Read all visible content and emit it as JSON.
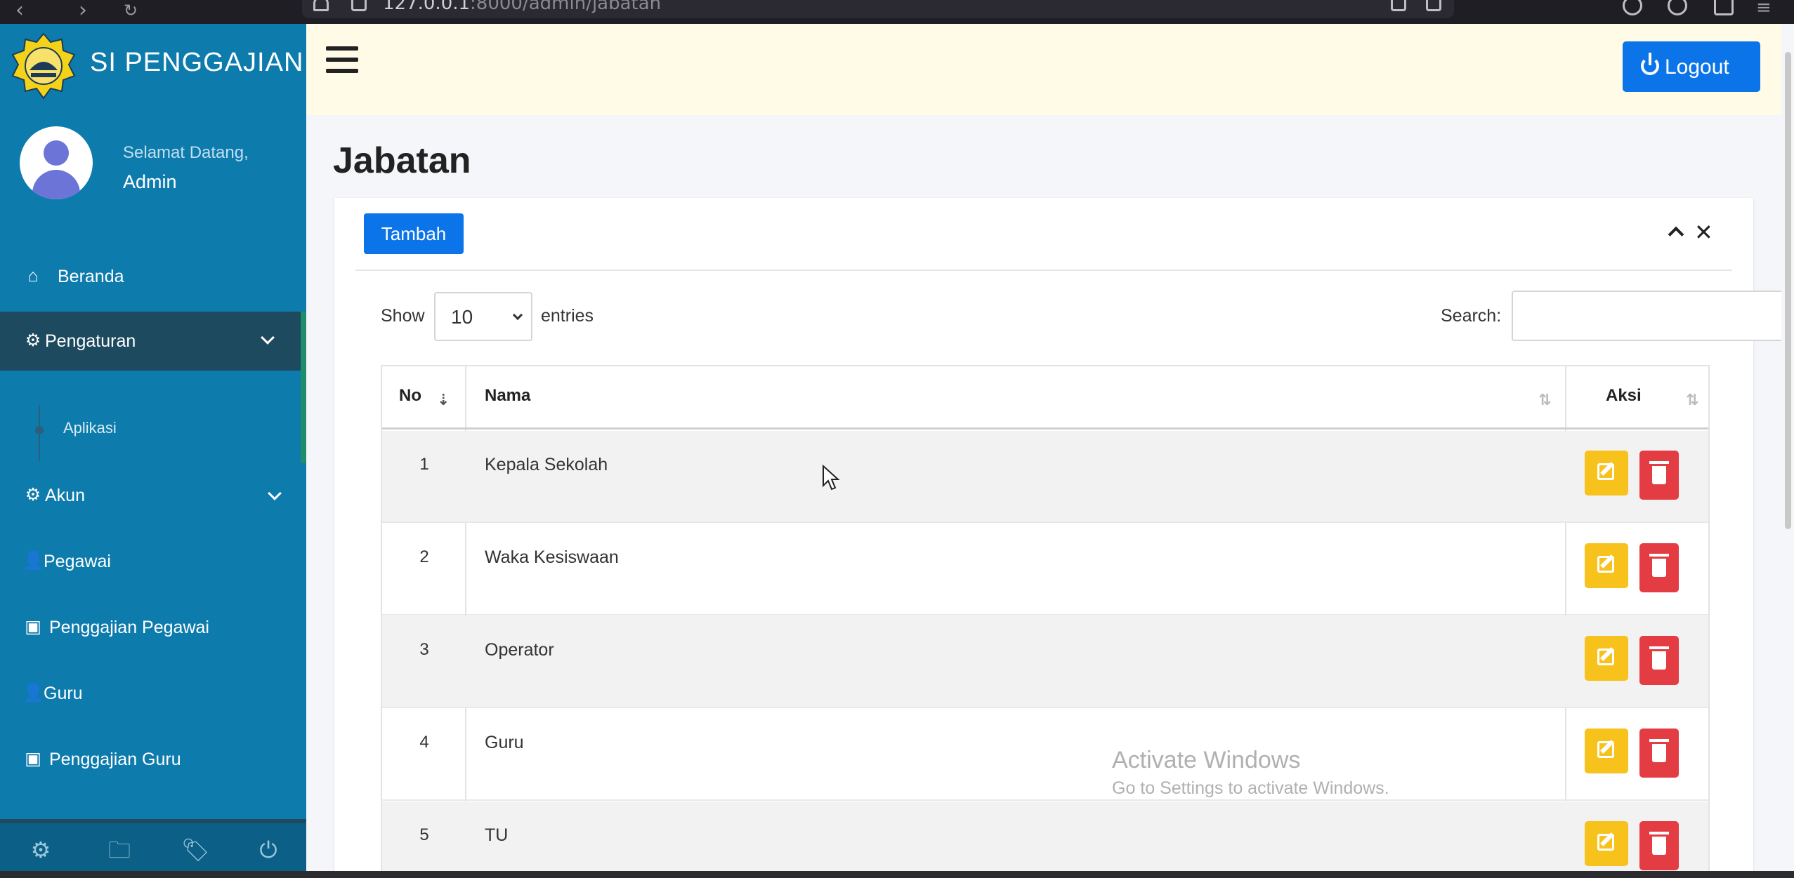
{
  "browser": {
    "url_host": "127.0.0.1",
    "url_rest": ":8000/admin/jabatan"
  },
  "brand": {
    "title": "SI PENGGAJIAN"
  },
  "user_panel": {
    "welcome": "Selamat Datang,",
    "name": "Admin"
  },
  "sidebar": {
    "items": [
      {
        "label": "Beranda",
        "icon": "home-icon"
      },
      {
        "label": "Pengaturan",
        "icon": "gear-icon"
      },
      {
        "label": "Akun",
        "icon": "gear-icon"
      },
      {
        "label": "Pegawai",
        "icon": "user-icon"
      },
      {
        "label": "Penggajian Pegawai",
        "icon": "money-icon"
      },
      {
        "label": "Guru",
        "icon": "teacher-icon"
      },
      {
        "label": "Penggajian Guru",
        "icon": "money-icon"
      }
    ],
    "submenu": {
      "label": "Aplikasi"
    },
    "footer_icons": [
      "gear-icon",
      "folder-icon",
      "tags-icon",
      "power-icon"
    ]
  },
  "header": {
    "logout_label": "Logout"
  },
  "page": {
    "title": "Jabatan"
  },
  "card": {
    "add_label": "Tambah",
    "show_label": "Show",
    "entries_value": "10",
    "entries_label": "entries",
    "search_label": "Search:",
    "search_value": ""
  },
  "table": {
    "columns": [
      "No",
      "Nama",
      "Aksi"
    ],
    "rows": [
      {
        "no": "1",
        "nama": "Kepala Sekolah"
      },
      {
        "no": "2",
        "nama": "Waka Kesiswaan"
      },
      {
        "no": "3",
        "nama": "Operator"
      },
      {
        "no": "4",
        "nama": "Guru"
      },
      {
        "no": "5",
        "nama": "TU"
      }
    ]
  },
  "watermark": {
    "title": "Activate Windows",
    "subtitle": "Go to Settings to activate Windows."
  },
  "colors": {
    "sidebar": "#0e7bad",
    "primary": "#0b74e8",
    "warning": "#f6c21b",
    "danger": "#e33d43"
  }
}
